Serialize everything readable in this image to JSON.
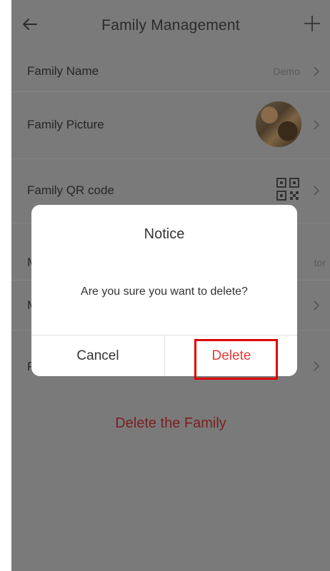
{
  "header": {
    "title": "Family Management",
    "back_icon": "arrow-left-icon",
    "add_icon": "plus-icon"
  },
  "settings": {
    "family_name": {
      "label": "Family Name",
      "value": "Demo"
    },
    "family_picture": {
      "label": "Family Picture"
    },
    "family_qr": {
      "label": "Family QR code"
    },
    "my_role": {
      "label": "My",
      "value": "tor"
    },
    "members": {
      "label": "M"
    },
    "rooms": {
      "label": "Ro"
    }
  },
  "delete_family_label": "Delete the Family",
  "dialog": {
    "title": "Notice",
    "message": "Are you sure you want to delete?",
    "cancel_label": "Cancel",
    "delete_label": "Delete"
  },
  "colors": {
    "overlay_bg": "#7a7a7a",
    "delete_accent": "#e53935",
    "highlight": "#e00000"
  }
}
